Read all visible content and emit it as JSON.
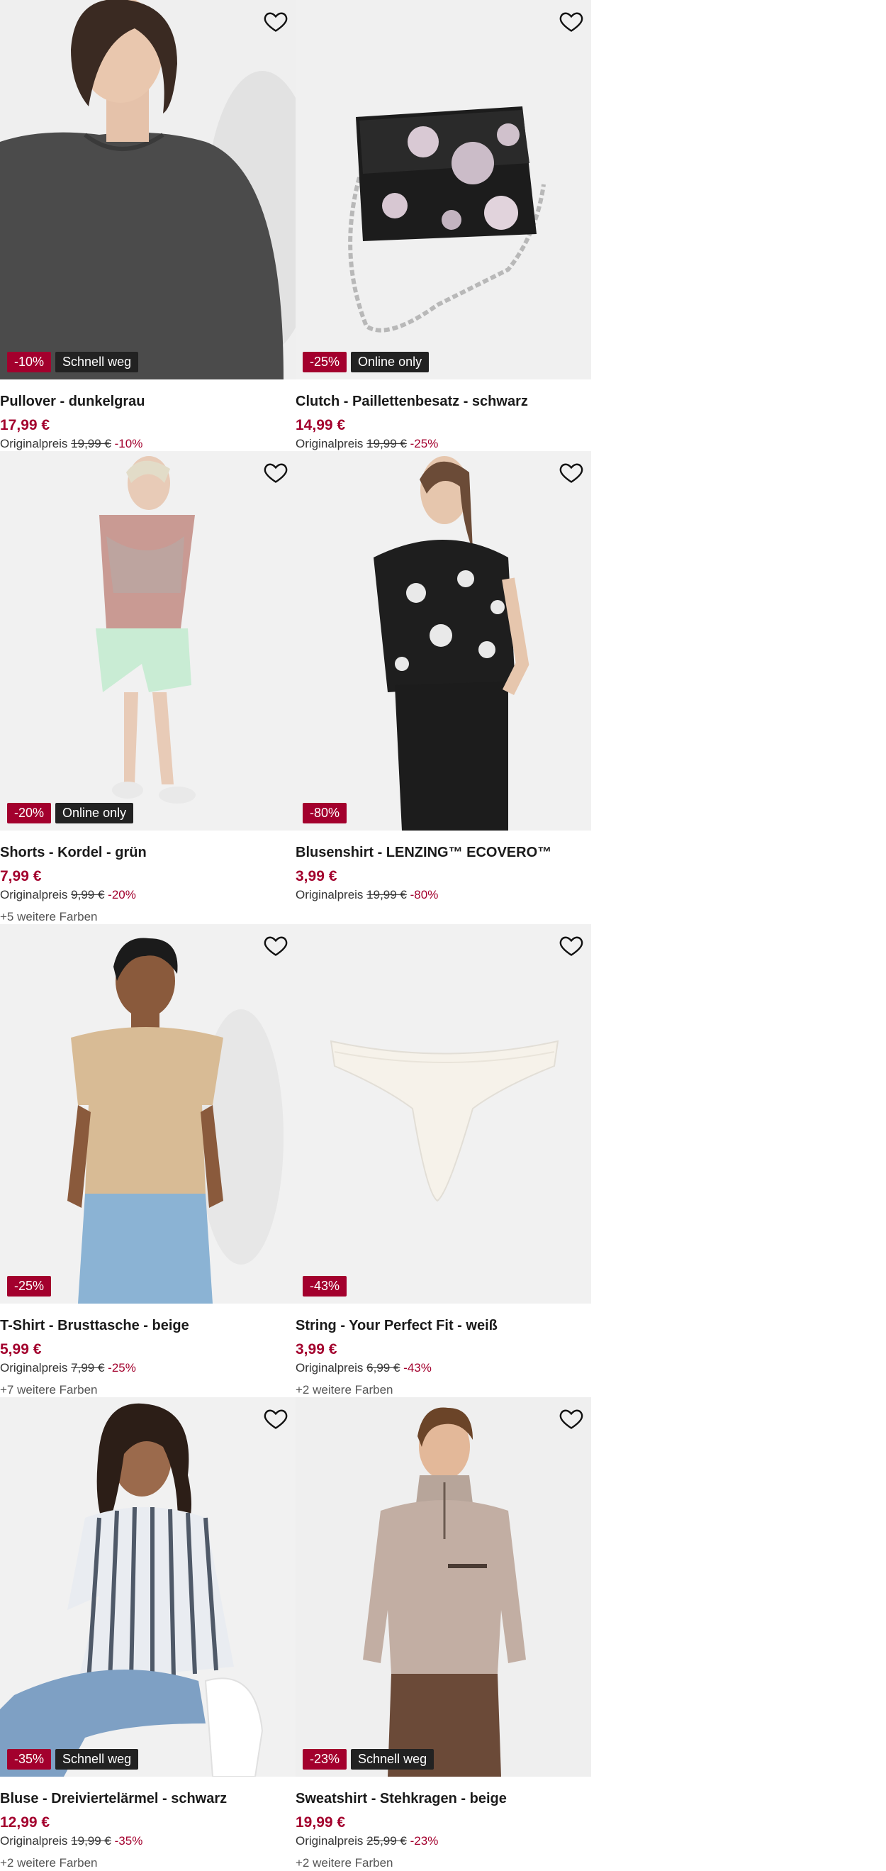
{
  "favorite_icon": "heart-outline-icon",
  "colors": {
    "sale": "#a3002d",
    "info_badge": "#222222",
    "tile_bg": "#f1f1f1"
  },
  "products": [
    {
      "title": "Pullover - dunkelgrau",
      "price": "17,99 €",
      "orig_label": "Originalpreis",
      "orig_price": "19,99 €",
      "discount": "-10%",
      "badge_discount": "-10%",
      "badge_info": "Schnell weg",
      "more_colors": ""
    },
    {
      "title": "Clutch - Paillettenbesatz - schwarz",
      "price": "14,99 €",
      "orig_label": "Originalpreis",
      "orig_price": "19,99 €",
      "discount": "-25%",
      "badge_discount": "-25%",
      "badge_info": "Online only",
      "more_colors": ""
    },
    {
      "title": "Shorts - Kordel - grün",
      "price": "7,99 €",
      "orig_label": "Originalpreis",
      "orig_price": "9,99 €",
      "discount": "-20%",
      "badge_discount": "-20%",
      "badge_info": "Online only",
      "more_colors": "+5 weitere Farben"
    },
    {
      "title": "Blusenshirt - LENZING™ ECOVERO™",
      "price": "3,99 €",
      "orig_label": "Originalpreis",
      "orig_price": "19,99 €",
      "discount": "-80%",
      "badge_discount": "-80%",
      "badge_info": "",
      "more_colors": ""
    },
    {
      "title": "T-Shirt - Brusttasche - beige",
      "price": "5,99 €",
      "orig_label": "Originalpreis",
      "orig_price": "7,99 €",
      "discount": "-25%",
      "badge_discount": "-25%",
      "badge_info": "",
      "more_colors": "+7 weitere Farben"
    },
    {
      "title": "String - Your Perfect Fit - weiß",
      "price": "3,99 €",
      "orig_label": "Originalpreis",
      "orig_price": "6,99 €",
      "discount": "-43%",
      "badge_discount": "-43%",
      "badge_info": "",
      "more_colors": "+2 weitere Farben"
    },
    {
      "title": "Bluse - Dreiviertelärmel - schwarz",
      "price": "12,99 €",
      "orig_label": "Originalpreis",
      "orig_price": "19,99 €",
      "discount": "-35%",
      "badge_discount": "-35%",
      "badge_info": "Schnell weg",
      "more_colors": "+2 weitere Farben"
    },
    {
      "title": "Sweatshirt - Stehkragen - beige",
      "price": "19,99 €",
      "orig_label": "Originalpreis",
      "orig_price": "25,99 €",
      "discount": "-23%",
      "badge_discount": "-23%",
      "badge_info": "Schnell weg",
      "more_colors": "+2 weitere Farben"
    }
  ]
}
